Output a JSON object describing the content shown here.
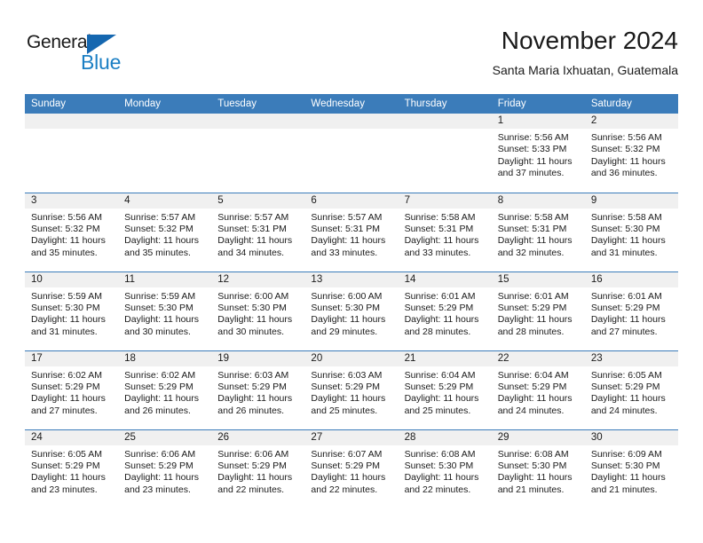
{
  "brand": {
    "word_general": "General",
    "word_blue": "Blue",
    "accent_color": "#1b7fc4",
    "triangle_color": "#1567b0"
  },
  "header": {
    "title": "November 2024",
    "subtitle": "Santa Maria Ixhuatan, Guatemala"
  },
  "calendar": {
    "header_bg": "#3b7cba",
    "day_band_bg": "#f0f0f0",
    "weekday_headers": [
      "Sunday",
      "Monday",
      "Tuesday",
      "Wednesday",
      "Thursday",
      "Friday",
      "Saturday"
    ],
    "weeks": [
      [
        {
          "day": "",
          "empty": true
        },
        {
          "day": "",
          "empty": true
        },
        {
          "day": "",
          "empty": true
        },
        {
          "day": "",
          "empty": true
        },
        {
          "day": "",
          "empty": true
        },
        {
          "day": "1",
          "sunrise": "Sunrise: 5:56 AM",
          "sunset": "Sunset: 5:33 PM",
          "daylight_line1": "Daylight: 11 hours",
          "daylight_line2": "and 37 minutes."
        },
        {
          "day": "2",
          "sunrise": "Sunrise: 5:56 AM",
          "sunset": "Sunset: 5:32 PM",
          "daylight_line1": "Daylight: 11 hours",
          "daylight_line2": "and 36 minutes."
        }
      ],
      [
        {
          "day": "3",
          "sunrise": "Sunrise: 5:56 AM",
          "sunset": "Sunset: 5:32 PM",
          "daylight_line1": "Daylight: 11 hours",
          "daylight_line2": "and 35 minutes."
        },
        {
          "day": "4",
          "sunrise": "Sunrise: 5:57 AM",
          "sunset": "Sunset: 5:32 PM",
          "daylight_line1": "Daylight: 11 hours",
          "daylight_line2": "and 35 minutes."
        },
        {
          "day": "5",
          "sunrise": "Sunrise: 5:57 AM",
          "sunset": "Sunset: 5:31 PM",
          "daylight_line1": "Daylight: 11 hours",
          "daylight_line2": "and 34 minutes."
        },
        {
          "day": "6",
          "sunrise": "Sunrise: 5:57 AM",
          "sunset": "Sunset: 5:31 PM",
          "daylight_line1": "Daylight: 11 hours",
          "daylight_line2": "and 33 minutes."
        },
        {
          "day": "7",
          "sunrise": "Sunrise: 5:58 AM",
          "sunset": "Sunset: 5:31 PM",
          "daylight_line1": "Daylight: 11 hours",
          "daylight_line2": "and 33 minutes."
        },
        {
          "day": "8",
          "sunrise": "Sunrise: 5:58 AM",
          "sunset": "Sunset: 5:31 PM",
          "daylight_line1": "Daylight: 11 hours",
          "daylight_line2": "and 32 minutes."
        },
        {
          "day": "9",
          "sunrise": "Sunrise: 5:58 AM",
          "sunset": "Sunset: 5:30 PM",
          "daylight_line1": "Daylight: 11 hours",
          "daylight_line2": "and 31 minutes."
        }
      ],
      [
        {
          "day": "10",
          "sunrise": "Sunrise: 5:59 AM",
          "sunset": "Sunset: 5:30 PM",
          "daylight_line1": "Daylight: 11 hours",
          "daylight_line2": "and 31 minutes."
        },
        {
          "day": "11",
          "sunrise": "Sunrise: 5:59 AM",
          "sunset": "Sunset: 5:30 PM",
          "daylight_line1": "Daylight: 11 hours",
          "daylight_line2": "and 30 minutes."
        },
        {
          "day": "12",
          "sunrise": "Sunrise: 6:00 AM",
          "sunset": "Sunset: 5:30 PM",
          "daylight_line1": "Daylight: 11 hours",
          "daylight_line2": "and 30 minutes."
        },
        {
          "day": "13",
          "sunrise": "Sunrise: 6:00 AM",
          "sunset": "Sunset: 5:30 PM",
          "daylight_line1": "Daylight: 11 hours",
          "daylight_line2": "and 29 minutes."
        },
        {
          "day": "14",
          "sunrise": "Sunrise: 6:01 AM",
          "sunset": "Sunset: 5:29 PM",
          "daylight_line1": "Daylight: 11 hours",
          "daylight_line2": "and 28 minutes."
        },
        {
          "day": "15",
          "sunrise": "Sunrise: 6:01 AM",
          "sunset": "Sunset: 5:29 PM",
          "daylight_line1": "Daylight: 11 hours",
          "daylight_line2": "and 28 minutes."
        },
        {
          "day": "16",
          "sunrise": "Sunrise: 6:01 AM",
          "sunset": "Sunset: 5:29 PM",
          "daylight_line1": "Daylight: 11 hours",
          "daylight_line2": "and 27 minutes."
        }
      ],
      [
        {
          "day": "17",
          "sunrise": "Sunrise: 6:02 AM",
          "sunset": "Sunset: 5:29 PM",
          "daylight_line1": "Daylight: 11 hours",
          "daylight_line2": "and 27 minutes."
        },
        {
          "day": "18",
          "sunrise": "Sunrise: 6:02 AM",
          "sunset": "Sunset: 5:29 PM",
          "daylight_line1": "Daylight: 11 hours",
          "daylight_line2": "and 26 minutes."
        },
        {
          "day": "19",
          "sunrise": "Sunrise: 6:03 AM",
          "sunset": "Sunset: 5:29 PM",
          "daylight_line1": "Daylight: 11 hours",
          "daylight_line2": "and 26 minutes."
        },
        {
          "day": "20",
          "sunrise": "Sunrise: 6:03 AM",
          "sunset": "Sunset: 5:29 PM",
          "daylight_line1": "Daylight: 11 hours",
          "daylight_line2": "and 25 minutes."
        },
        {
          "day": "21",
          "sunrise": "Sunrise: 6:04 AM",
          "sunset": "Sunset: 5:29 PM",
          "daylight_line1": "Daylight: 11 hours",
          "daylight_line2": "and 25 minutes."
        },
        {
          "day": "22",
          "sunrise": "Sunrise: 6:04 AM",
          "sunset": "Sunset: 5:29 PM",
          "daylight_line1": "Daylight: 11 hours",
          "daylight_line2": "and 24 minutes."
        },
        {
          "day": "23",
          "sunrise": "Sunrise: 6:05 AM",
          "sunset": "Sunset: 5:29 PM",
          "daylight_line1": "Daylight: 11 hours",
          "daylight_line2": "and 24 minutes."
        }
      ],
      [
        {
          "day": "24",
          "sunrise": "Sunrise: 6:05 AM",
          "sunset": "Sunset: 5:29 PM",
          "daylight_line1": "Daylight: 11 hours",
          "daylight_line2": "and 23 minutes."
        },
        {
          "day": "25",
          "sunrise": "Sunrise: 6:06 AM",
          "sunset": "Sunset: 5:29 PM",
          "daylight_line1": "Daylight: 11 hours",
          "daylight_line2": "and 23 minutes."
        },
        {
          "day": "26",
          "sunrise": "Sunrise: 6:06 AM",
          "sunset": "Sunset: 5:29 PM",
          "daylight_line1": "Daylight: 11 hours",
          "daylight_line2": "and 22 minutes."
        },
        {
          "day": "27",
          "sunrise": "Sunrise: 6:07 AM",
          "sunset": "Sunset: 5:29 PM",
          "daylight_line1": "Daylight: 11 hours",
          "daylight_line2": "and 22 minutes."
        },
        {
          "day": "28",
          "sunrise": "Sunrise: 6:08 AM",
          "sunset": "Sunset: 5:30 PM",
          "daylight_line1": "Daylight: 11 hours",
          "daylight_line2": "and 22 minutes."
        },
        {
          "day": "29",
          "sunrise": "Sunrise: 6:08 AM",
          "sunset": "Sunset: 5:30 PM",
          "daylight_line1": "Daylight: 11 hours",
          "daylight_line2": "and 21 minutes."
        },
        {
          "day": "30",
          "sunrise": "Sunrise: 6:09 AM",
          "sunset": "Sunset: 5:30 PM",
          "daylight_line1": "Daylight: 11 hours",
          "daylight_line2": "and 21 minutes."
        }
      ]
    ]
  }
}
